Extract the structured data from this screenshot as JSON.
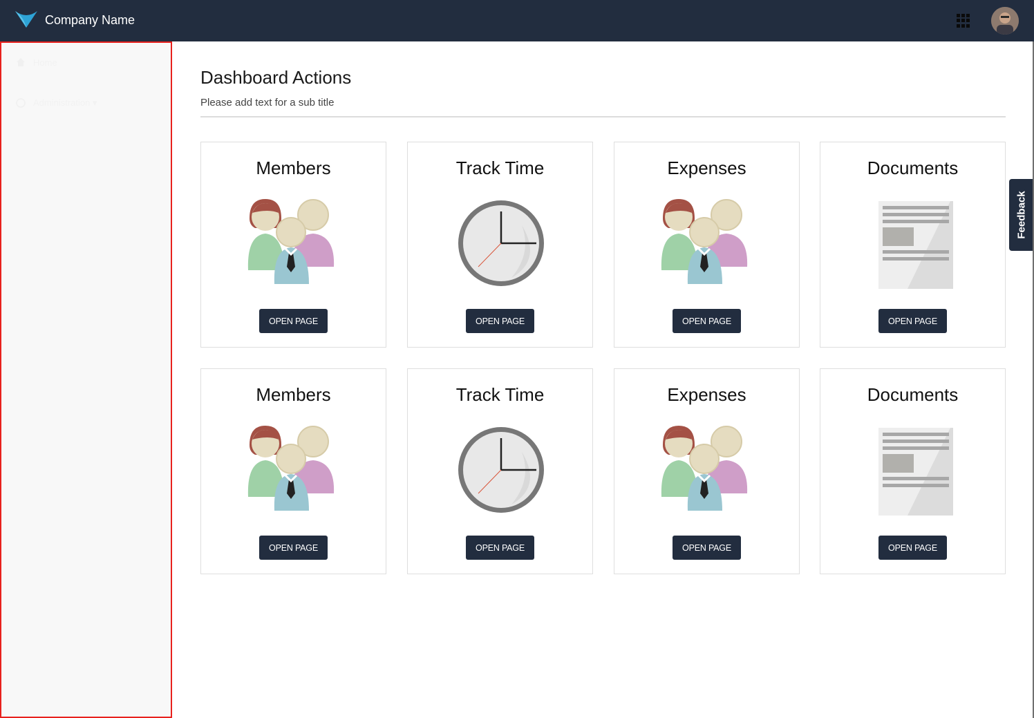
{
  "header": {
    "brand": "Company Name",
    "apps_icon": "grid-icon",
    "avatar": "user-avatar"
  },
  "sidebar": {
    "items": [
      {
        "label": "Home",
        "icon": "home-icon"
      },
      {
        "label": "Administration ▾",
        "icon": "settings-icon"
      }
    ]
  },
  "main": {
    "title": "Dashboard Actions",
    "subtitle": "Please add text for a sub title",
    "cards": [
      {
        "title": "Members",
        "icon": "members-icon",
        "button": "OPEN PAGE"
      },
      {
        "title": "Track Time",
        "icon": "clock-icon",
        "button": "OPEN PAGE"
      },
      {
        "title": "Expenses",
        "icon": "members-icon",
        "button": "OPEN PAGE"
      },
      {
        "title": "Documents",
        "icon": "document-icon",
        "button": "OPEN PAGE"
      },
      {
        "title": "Members",
        "icon": "members-icon",
        "button": "OPEN PAGE"
      },
      {
        "title": "Track Time",
        "icon": "clock-icon",
        "button": "OPEN PAGE"
      },
      {
        "title": "Expenses",
        "icon": "members-icon",
        "button": "OPEN PAGE"
      },
      {
        "title": "Documents",
        "icon": "document-icon",
        "button": "OPEN PAGE"
      }
    ]
  },
  "feedback": {
    "label": "Feedback"
  },
  "colors": {
    "header_bg": "#222d3f",
    "button_bg": "#222d3f",
    "sidebar_bg": "#f8f8f8",
    "sidebar_border": "#e8211d"
  }
}
